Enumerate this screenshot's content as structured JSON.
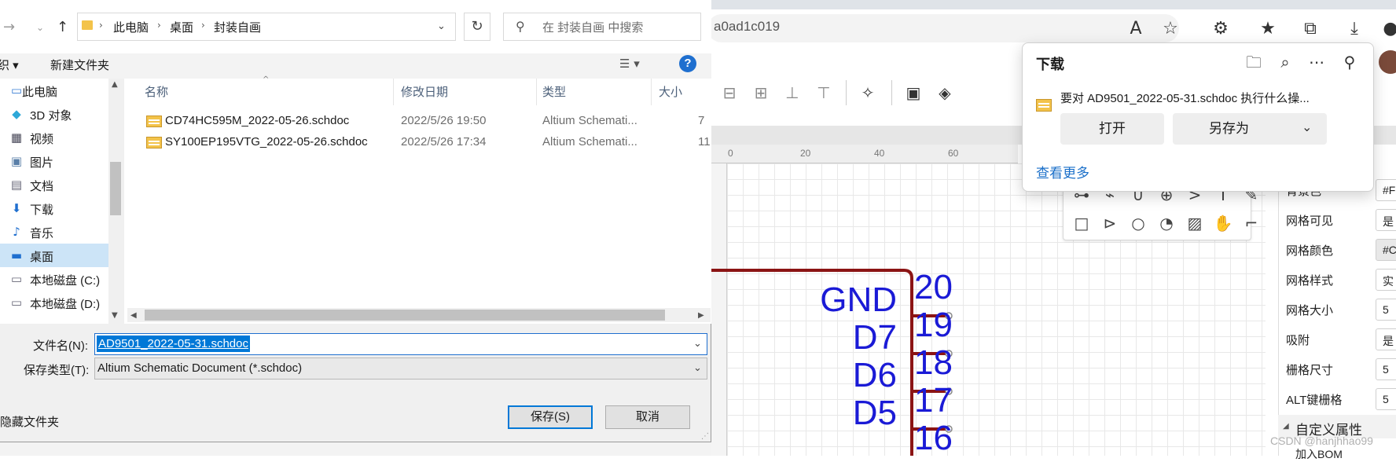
{
  "browser": {
    "address_fragment": "a0ad1c019",
    "toolbar_icons": [
      "read-aloud-icon",
      "add-favorite-icon",
      "extensions-icon",
      "favorites-icon",
      "collections-icon",
      "downloads-icon",
      "profile-icon"
    ]
  },
  "downloads_panel": {
    "title": "下载",
    "question": "要对 AD9501_2022-05-31.schdoc 执行什么操...",
    "open_label": "打开",
    "save_as_label": "另存为",
    "see_more_label": "查看更多"
  },
  "canvas": {
    "ruler_labels": [
      "0",
      "20",
      "40",
      "60"
    ],
    "pins": [
      {
        "name": "GND",
        "number": "20"
      },
      {
        "name": "D7",
        "number": "19"
      },
      {
        "name": "D6",
        "number": "18"
      },
      {
        "name": "D5",
        "number": "17"
      },
      {
        "name": "",
        "number": "16"
      }
    ],
    "colors": {
      "wire": "#8b1414",
      "pin_text": "#1a1ad6",
      "accent": "#0078d7"
    }
  },
  "properties": {
    "rows": [
      {
        "label": "背景色",
        "value": "#F"
      },
      {
        "label": "网格可见",
        "value": "是"
      },
      {
        "label": "网格颜色",
        "value": "#C"
      },
      {
        "label": "网格样式",
        "value": "实"
      },
      {
        "label": "网格大小",
        "value": "5"
      },
      {
        "label": "吸附",
        "value": "是"
      },
      {
        "label": "栅格尺寸",
        "value": "5"
      },
      {
        "label": "ALT键栅格",
        "value": "5"
      }
    ],
    "section_title": "自定义属性",
    "next_row": "加入BOM",
    "watermark": "CSDN @hanjhhao99"
  },
  "dialog": {
    "breadcrumb": [
      "此电脑",
      "桌面",
      "封装自画"
    ],
    "search_placeholder": "在 封装自画 中搜索",
    "organize_label": "组织 ▾",
    "new_folder_label": "新建文件夹",
    "help_label": "?",
    "tree": [
      {
        "label": "此电脑",
        "icon": "pc-icon"
      },
      {
        "label": "3D 对象",
        "icon": "3d-objects-icon"
      },
      {
        "label": "视频",
        "icon": "video-icon"
      },
      {
        "label": "图片",
        "icon": "pictures-icon"
      },
      {
        "label": "文档",
        "icon": "documents-icon"
      },
      {
        "label": "下载",
        "icon": "downloads-icon"
      },
      {
        "label": "音乐",
        "icon": "music-icon"
      },
      {
        "label": "桌面",
        "icon": "desktop-icon"
      },
      {
        "label": "本地磁盘 (C:)",
        "icon": "drive-icon"
      },
      {
        "label": "本地磁盘 (D:)",
        "icon": "drive-icon"
      }
    ],
    "columns": {
      "name": "名称",
      "date": "修改日期",
      "type": "类型",
      "size": "大小"
    },
    "files": [
      {
        "name": "CD74HC595M_2022-05-26.schdoc",
        "date": "2022/5/26 19:50",
        "type": "Altium Schemati...",
        "size": "7"
      },
      {
        "name": "SY100EP195VTG_2022-05-26.schdoc",
        "date": "2022/5/26 17:34",
        "type": "Altium Schemati...",
        "size": "11"
      }
    ],
    "filename_label": "文件名(N):",
    "filename_value": "AD9501_2022-05-31.schdoc",
    "filetype_label": "保存类型(T):",
    "filetype_value": "Altium Schematic Document (*.schdoc)",
    "hide_folders_label": "隐藏文件夹",
    "save_label": "保存(S)",
    "cancel_label": "取消"
  }
}
